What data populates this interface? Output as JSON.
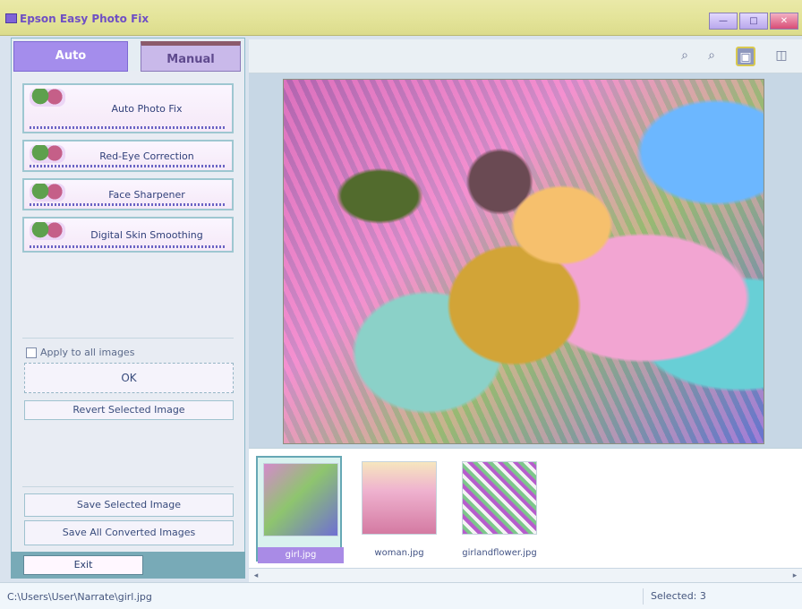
{
  "window": {
    "title": "Epson Easy Photo Fix"
  },
  "tabs": [
    {
      "label": "Auto"
    },
    {
      "label": "Manual"
    }
  ],
  "auto_fixes": [
    {
      "label": "Auto Photo Fix"
    },
    {
      "label": "Red-Eye Correction"
    },
    {
      "label": "Face Sharpener"
    },
    {
      "label": "Digital Skin Smoothing"
    }
  ],
  "controls": {
    "apply_all_label": "Apply to all images",
    "ok_label": "OK",
    "revert_label": "Revert Selected Image",
    "save_selected_label": "Save Selected Image",
    "save_all_label": "Save All Converted Images",
    "exit_label": "Exit"
  },
  "toolbar": {
    "icons": [
      "zoom-in-icon",
      "zoom-out-icon",
      "single-view-icon",
      "compare-view-icon"
    ]
  },
  "thumbnails": [
    {
      "name": "girl.jpg",
      "selected": true
    },
    {
      "name": "woman.jpg",
      "selected": false
    },
    {
      "name": "girlandflower.jpg",
      "selected": false
    }
  ],
  "status": {
    "path": "C:\\Users\\User\\Narrate\\girl.jpg",
    "selected": "Selected: 3"
  }
}
